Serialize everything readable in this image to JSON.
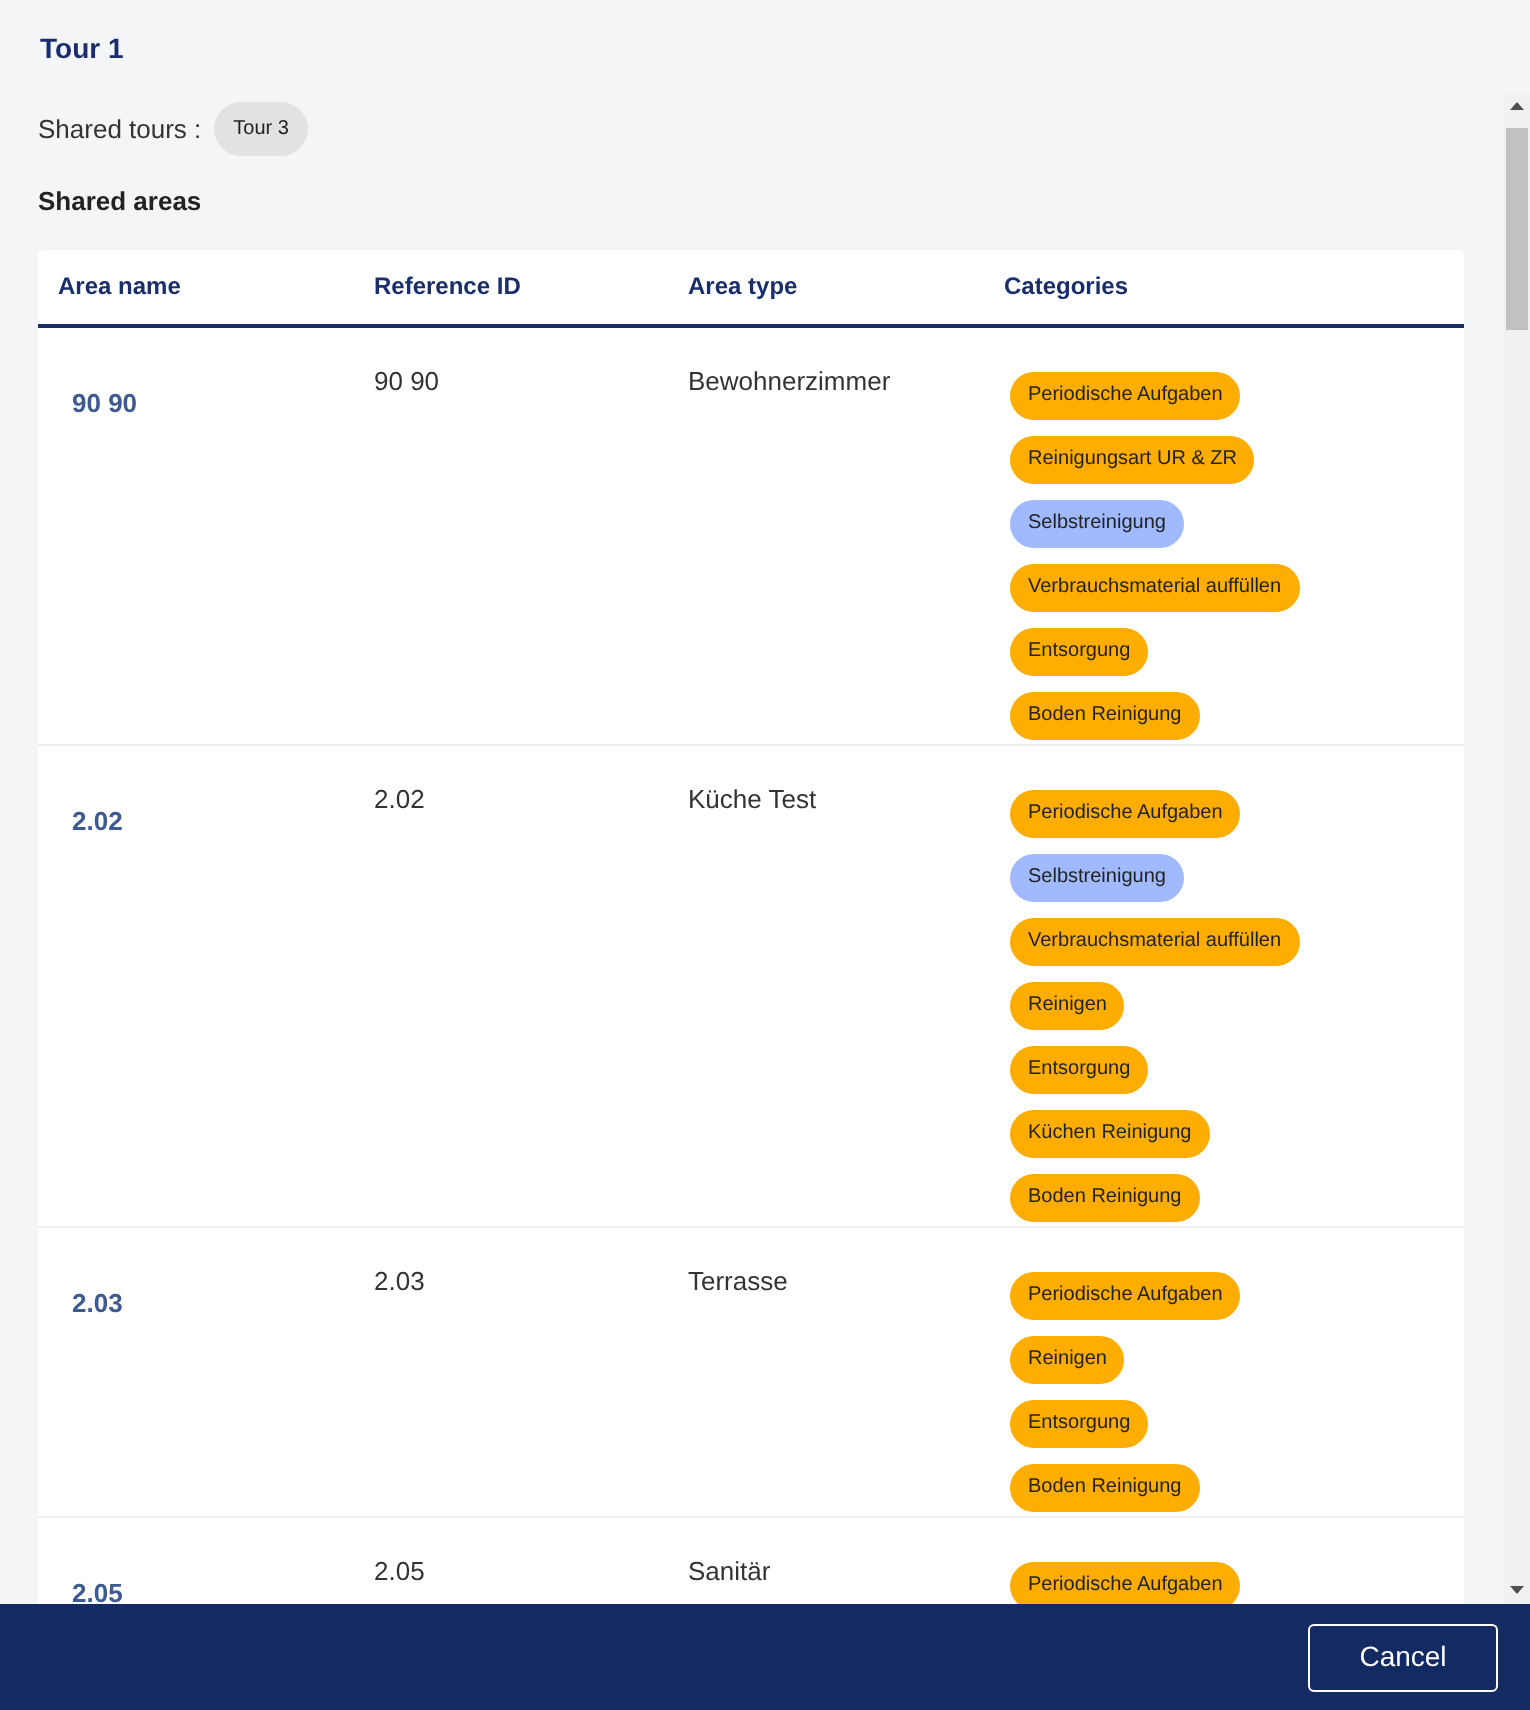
{
  "title": "Tour 1",
  "shared_tours": {
    "label": "Shared tours :",
    "tours": [
      "Tour 3"
    ]
  },
  "section_title": "Shared areas",
  "table": {
    "columns": [
      "Area name",
      "Reference ID",
      "Area type",
      "Categories"
    ],
    "rows": [
      {
        "area_name": "90 90",
        "reference_id": "90 90",
        "area_type": "Bewohnerzimmer",
        "categories": [
          {
            "label": "Periodische Aufgaben",
            "color": "#ffad00"
          },
          {
            "label": "Reinigungsart UR & ZR",
            "color": "#ffad00"
          },
          {
            "label": "Selbstreinigung",
            "color": "#a0b9ff"
          },
          {
            "label": "Verbrauchsmaterial auffüllen",
            "color": "#ffad00"
          },
          {
            "label": "Entsorgung",
            "color": "#ffad00"
          },
          {
            "label": "Boden Reinigung",
            "color": "#ffad00"
          }
        ]
      },
      {
        "area_name": "2.02",
        "reference_id": "2.02",
        "area_type": "Küche Test",
        "categories": [
          {
            "label": "Periodische Aufgaben",
            "color": "#ffad00"
          },
          {
            "label": "Selbstreinigung",
            "color": "#a0b9ff"
          },
          {
            "label": "Verbrauchsmaterial auffüllen",
            "color": "#ffad00"
          },
          {
            "label": "Reinigen",
            "color": "#ffad00"
          },
          {
            "label": "Entsorgung",
            "color": "#ffad00"
          },
          {
            "label": "Küchen Reinigung",
            "color": "#ffad00"
          },
          {
            "label": "Boden Reinigung",
            "color": "#ffad00"
          }
        ]
      },
      {
        "area_name": "2.03",
        "reference_id": "2.03",
        "area_type": "Terrasse",
        "categories": [
          {
            "label": "Periodische Aufgaben",
            "color": "#ffad00"
          },
          {
            "label": "Reinigen",
            "color": "#ffad00"
          },
          {
            "label": "Entsorgung",
            "color": "#ffad00"
          },
          {
            "label": "Boden Reinigung",
            "color": "#ffad00"
          }
        ]
      },
      {
        "area_name": "2.05",
        "reference_id": "2.05",
        "area_type": "Sanitär",
        "categories": [
          {
            "label": "Periodische Aufgaben",
            "color": "#ffad00"
          }
        ]
      }
    ]
  },
  "footer": {
    "buttons": [
      "Cancel"
    ]
  }
}
